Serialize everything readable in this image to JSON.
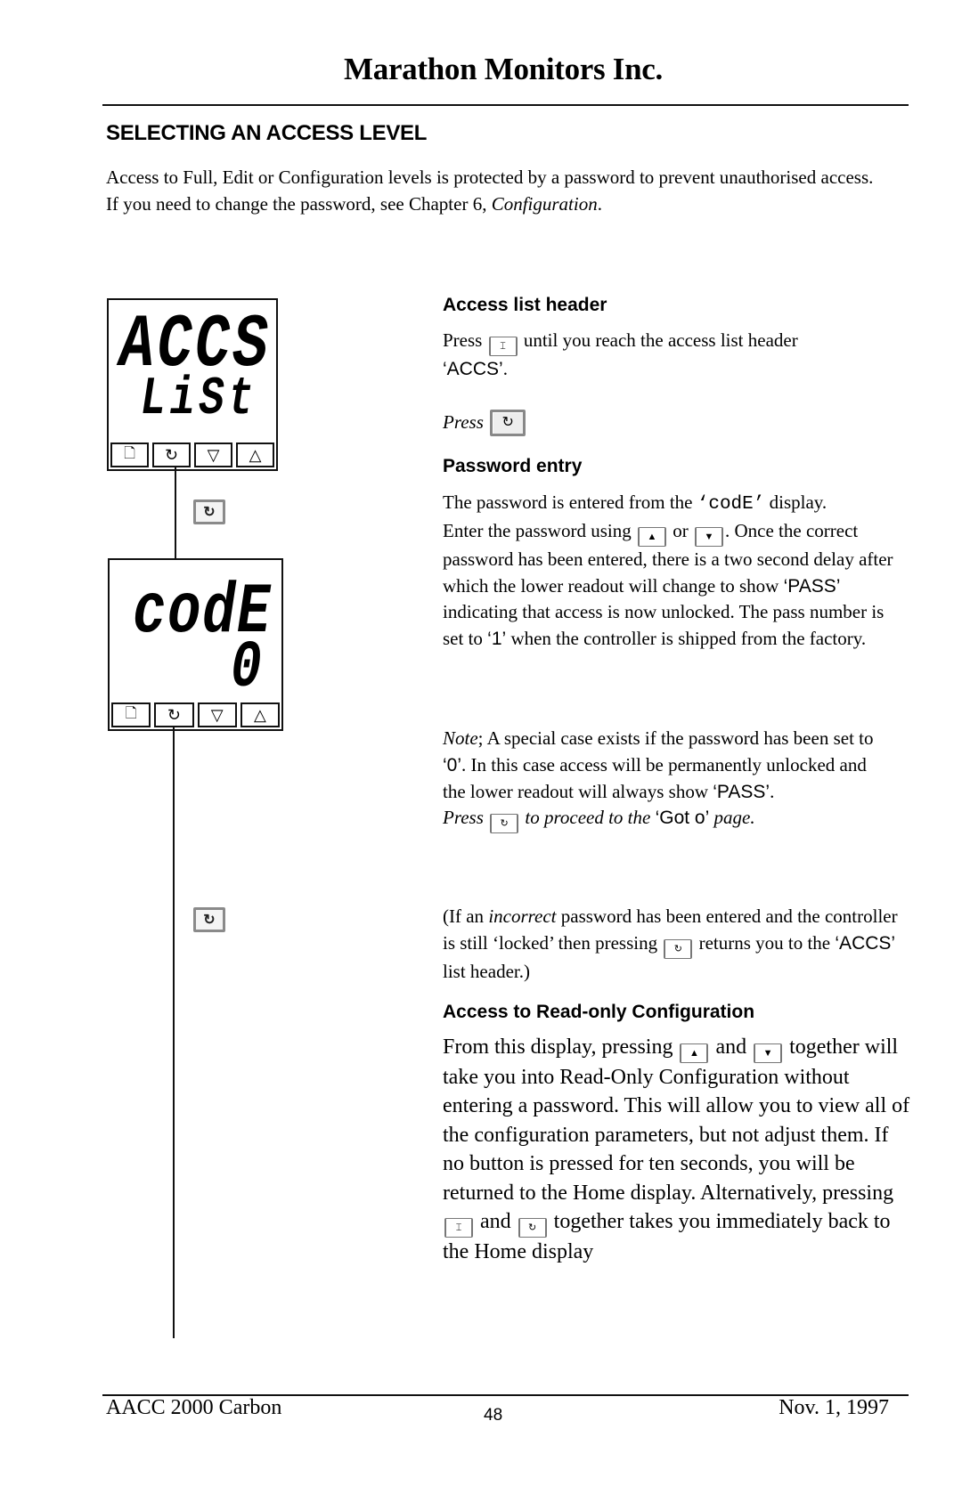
{
  "header": {
    "company": "Marathon Monitors Inc."
  },
  "section": {
    "title": "SELECTING AN ACCESS LEVEL",
    "intro_line1": "Access to Full, Edit or Configuration levels is protected by a password to prevent unauthorised access.",
    "intro_line2_a": "If you need to change the password, see Chapter 6, ",
    "intro_line2_em": "Configuration",
    "intro_line2_b": "."
  },
  "displays": [
    {
      "upper": "ACCS",
      "lower": "LiSt"
    },
    {
      "upper": "codE",
      "lower": "0"
    }
  ],
  "display_buttons": [
    "page-icon",
    "scroll-icon",
    "down-arrow-icon",
    "up-arrow-icon"
  ],
  "icons": {
    "page_key": "⌶",
    "scroll_key": "↻",
    "up_key": "▲",
    "down_key": "▼",
    "page_glyph": "🗋",
    "down_glyph": "▽",
    "up_glyph": "△"
  },
  "access_list": {
    "heading": "Access list header",
    "p1_a": "Press",
    "p1_b": "until you reach the access list header",
    "p1_code": "‘ACCS’",
    "p1_end": ".",
    "press_label": "Press"
  },
  "password_entry": {
    "heading": "Password entry",
    "l1_a": "The password is entered from the ",
    "l1_code": "‘codE’",
    "l1_b": " display.",
    "l2_a": "Enter the password using",
    "l2_or": "or",
    "l2_b": ".  Once the",
    "l3": "correct password has been entered, there is a two second delay after which the lower readout will change to show ",
    "l3_code": "‘PASS’",
    "l3_b": " indicating that access is now unlocked.",
    "l4_a": "The pass number is set to ",
    "l4_code": "‘1’",
    "l4_b": " when the controller is shipped from the factory."
  },
  "note": {
    "label": "Note",
    "a": "; A special case exists if the password has been set to ",
    "code0": "‘0’",
    "b": ".  In this case access will be permanently unlocked and the lower readout will always show ",
    "pass": "‘PASS’",
    "c": ".",
    "press_a": "Press",
    "press_b": "to proceed to the",
    "goto": "‘Got o’",
    "press_c": "page."
  },
  "incorrect": {
    "a": "(If an ",
    "em": "incorrect",
    "b": " password has been entered and the controller is still ‘locked’ then pressing",
    "c": "returns you to the ",
    "code": "‘ACCS’",
    "d": " list header.)"
  },
  "readonly": {
    "heading": "Access to Read-only Configuration",
    "a": "From this display, pressing",
    "and1": "and",
    "b": "together will take you into Read-Only Configuration without entering a password. This will allow you to view all of the configuration parameters, but not adjust them. If no button is pressed for ten seconds, you will be returned to the Home display. Alternatively, pressing",
    "and2": "and",
    "c": "together takes you immediately back to the Home display"
  },
  "footer": {
    "left": "AACC 2000 Carbon",
    "page": "48",
    "right": "Nov.  1, 1997"
  }
}
